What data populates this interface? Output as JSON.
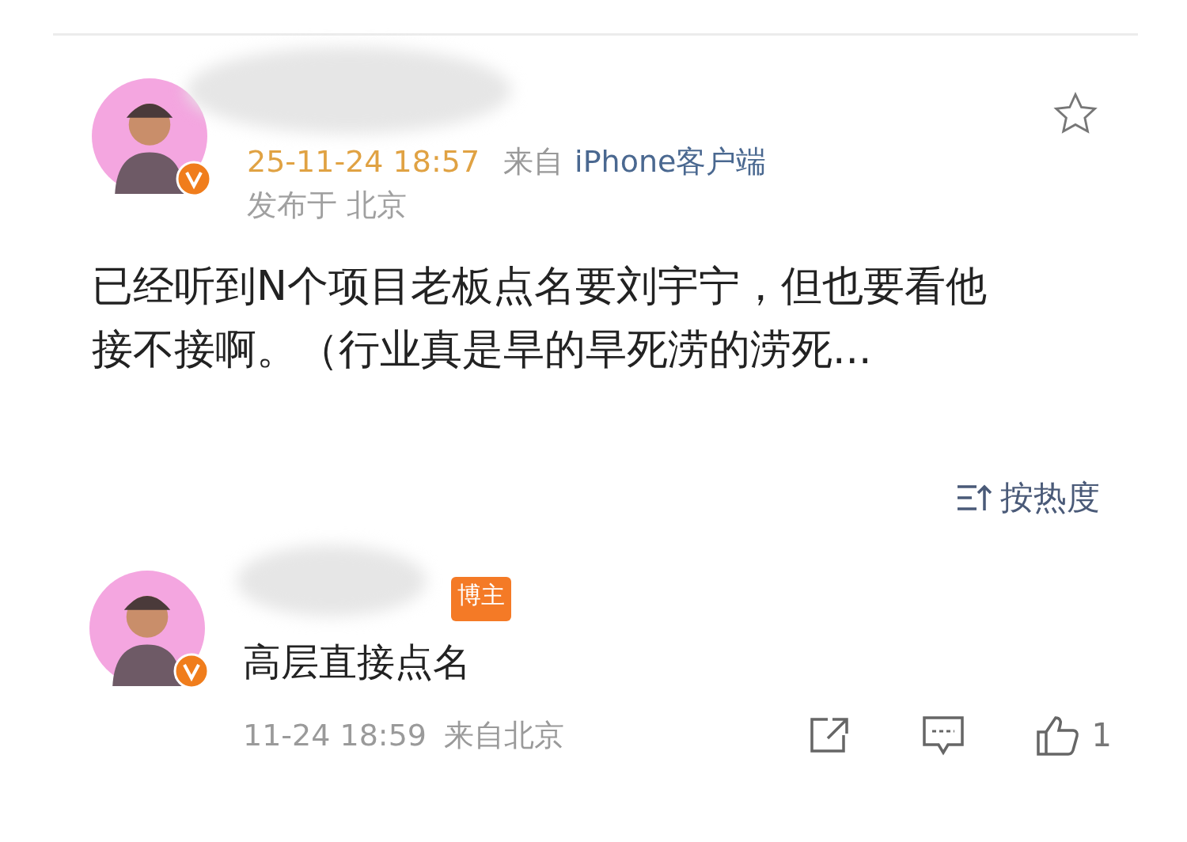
{
  "post": {
    "time": "25-11-24 18:57",
    "source_prefix": "来自",
    "source": "iPhone客户端",
    "location": "发布于 北京",
    "text": "已经听到N个项目老板点名要刘宇宁，但也要看他接不接啊。（行业真是旱的旱死涝的涝死...",
    "starred": false
  },
  "sort": {
    "label": "按热度"
  },
  "comment": {
    "badge": "博主",
    "text": "高层直接点名",
    "time": "11-24 18:59",
    "source": "来自北京",
    "likes": "1",
    "liked": false
  }
}
